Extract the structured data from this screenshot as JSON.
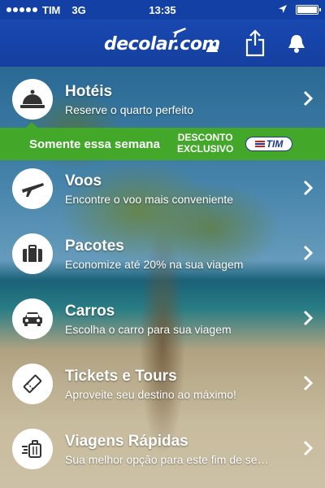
{
  "status_bar": {
    "carrier": "TIM",
    "network": "3G",
    "time": "13:35",
    "battery_level": 1.0
  },
  "header": {
    "logo_text": "decolar.com",
    "icons": [
      "share-icon",
      "notification-bell-icon"
    ]
  },
  "menu": [
    {
      "id": "hoteis",
      "icon": "hotel-bell-icon",
      "title": "Hotéis",
      "subtitle": "Reserve o quarto perfeito"
    },
    {
      "id": "voos",
      "icon": "airplane-icon",
      "title": "Voos",
      "subtitle": "Encontre o voo mais conveniente"
    },
    {
      "id": "pacotes",
      "icon": "suitcase-icon",
      "title": "Pacotes",
      "subtitle": "Economize até 20% na sua viagem"
    },
    {
      "id": "carros",
      "icon": "car-icon",
      "title": "Carros",
      "subtitle": "Escolha o carro para sua viagem"
    },
    {
      "id": "tickets",
      "icon": "ticket-icon",
      "title": "Tickets e Tours",
      "subtitle": "Aproveite seu destino ao máximo!"
    },
    {
      "id": "viagens",
      "icon": "fast-luggage-icon",
      "title": "Viagens Rápidas",
      "subtitle": "Sua melhor opção para este fim de se…"
    }
  ],
  "promo": {
    "text": "Somente essa semana",
    "discount_line1": "DESCONTO",
    "discount_line2": "EXCLUSIVO",
    "partner": "TIM",
    "color": "#43a82a"
  },
  "colors": {
    "header_blue": "#1848b0",
    "icon_blue": "#1d3a8a"
  }
}
